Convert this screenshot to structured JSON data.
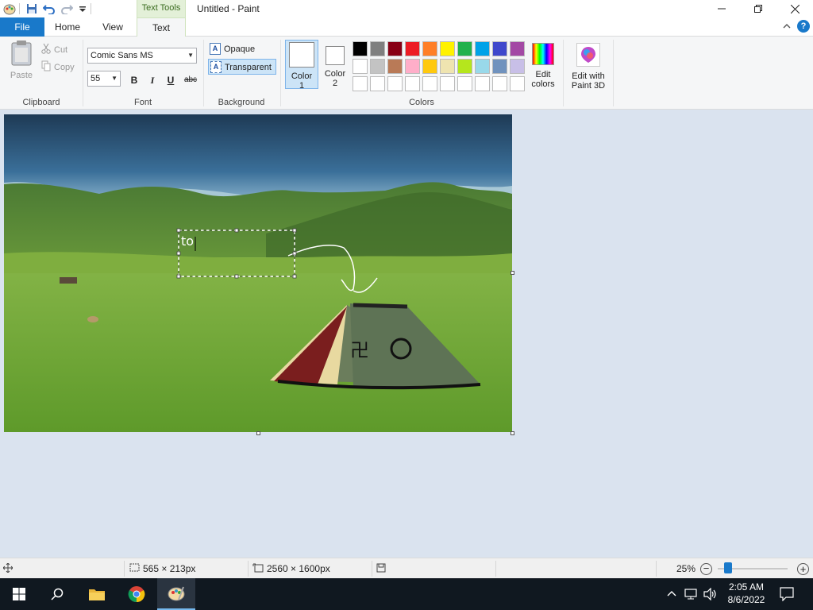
{
  "titlebar": {
    "title": "Untitled - Paint",
    "contextual_tab": "Text Tools"
  },
  "tabs": [
    {
      "label": "File"
    },
    {
      "label": "Home"
    },
    {
      "label": "View"
    },
    {
      "label": "Text"
    }
  ],
  "ribbon": {
    "clipboard": {
      "paste": "Paste",
      "cut": "Cut",
      "copy": "Copy",
      "group": "Clipboard"
    },
    "font": {
      "family": "Comic Sans MS",
      "size": "55",
      "bold": "B",
      "italic": "I",
      "underline": "U",
      "strike": "abc",
      "group": "Font"
    },
    "background": {
      "opaque": "Opaque",
      "transparent": "Transparent",
      "group": "Background"
    },
    "colors": {
      "color1": "Color\n1",
      "color1_l1": "Color",
      "color1_l2": "1",
      "color2_l1": "Color",
      "color2_l2": "2",
      "group": "Colors",
      "edit_l1": "Edit",
      "edit_l2": "colors",
      "palette_row1": [
        "#000000",
        "#7f7f7f",
        "#880015",
        "#ed1c24",
        "#ff7f27",
        "#fff200",
        "#22b14c",
        "#00a2e8",
        "#3f48cc",
        "#a349a4"
      ],
      "palette_row2": [
        "#ffffff",
        "#c3c3c3",
        "#b97a57",
        "#ffaec9",
        "#ffc90e",
        "#efe4b0",
        "#b5e61d",
        "#99d9ea",
        "#7092be",
        "#c8bfe7"
      ]
    },
    "paint3d": {
      "l1": "Edit with",
      "l2": "Paint 3D"
    }
  },
  "canvas": {
    "textbox_text": "to"
  },
  "status": {
    "selection_size": "565 × 213px",
    "image_size": "2560 × 1600px",
    "zoom": "25%"
  },
  "taskbar": {
    "time": "2:05 AM",
    "date": "8/6/2022"
  }
}
